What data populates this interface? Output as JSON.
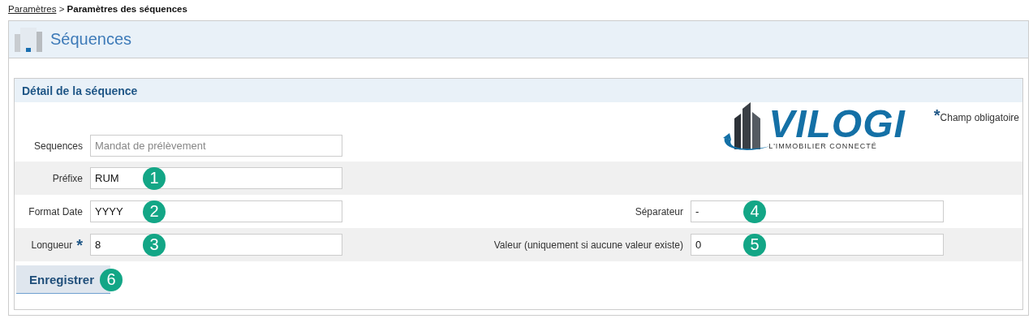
{
  "breadcrumb": {
    "link": "Paramètres",
    "separator": ">",
    "current": "Paramètres des séquences"
  },
  "page": {
    "title": "Séquences"
  },
  "panel": {
    "title": "Détail de la séquence",
    "logo": {
      "name": "VILOGI",
      "tagline": "L'IMMOBILIER CONNECTÉ"
    },
    "required_note": {
      "mark": "*",
      "text": "Champ obligatoire"
    }
  },
  "rows": [
    {
      "left": {
        "label": "Sequences",
        "value": "Mandat de prélèvement",
        "disabled": true
      }
    },
    {
      "left": {
        "label": "Préfixe",
        "value": "RUM",
        "disabled": false,
        "badge": "1"
      }
    },
    {
      "left": {
        "label": "Format Date",
        "value": "YYYY",
        "disabled": false,
        "badge": "2"
      },
      "right": {
        "label": "Séparateur",
        "value": "-",
        "disabled": false,
        "badge": "4"
      }
    },
    {
      "left": {
        "label": "Longueur",
        "required_mark": "*",
        "value": "8",
        "disabled": false,
        "badge": "3"
      },
      "right": {
        "label": "Valeur (uniquement si aucune valeur existe)",
        "value": "0",
        "disabled": false,
        "badge": "5"
      }
    }
  ],
  "button": {
    "label": "Enregistrer",
    "badge": "6"
  }
}
